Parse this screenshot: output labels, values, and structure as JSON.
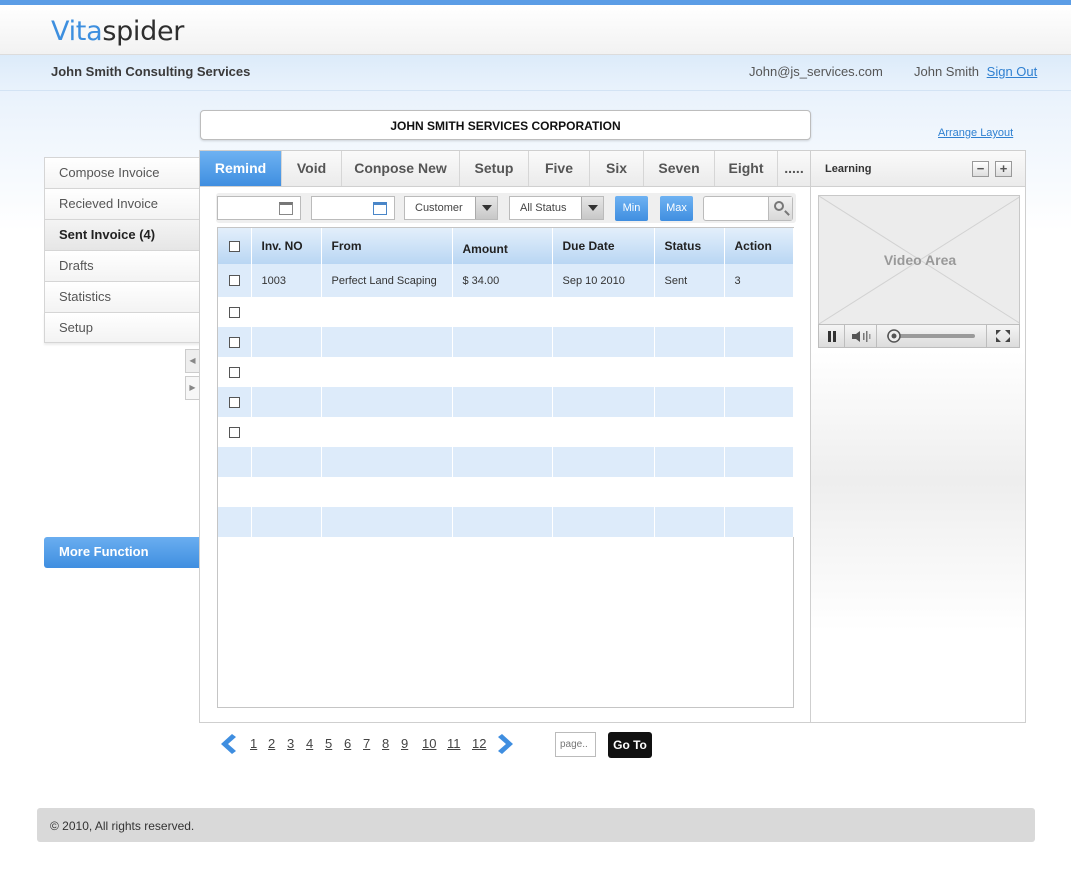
{
  "brand": {
    "logo_part1": "Vita",
    "logo_part2": "spider"
  },
  "header": {
    "company": "John Smith Consulting Services",
    "email": "John@js_services.com",
    "user": "John Smith",
    "signout_label": "Sign Out"
  },
  "corp_title": "JOHN SMITH SERVICES CORPORATION",
  "arrange_label": "Arrange Layout",
  "sidebar": {
    "items": [
      {
        "label": "Compose Invoice"
      },
      {
        "label": "Recieved Invoice"
      },
      {
        "label": "Sent Invoice (4)"
      },
      {
        "label": "Drafts"
      },
      {
        "label": "Statistics"
      },
      {
        "label": "Setup"
      }
    ],
    "more_label": "More Function"
  },
  "tabs": [
    "Remind",
    "Void",
    "Conpose New",
    "Setup",
    "Five",
    "Six",
    "Seven",
    "Eight",
    "....."
  ],
  "filters": {
    "customer": "Customer",
    "status": "All Status",
    "min_label": "Min",
    "max_label": "Max"
  },
  "table": {
    "columns": [
      "Inv. NO",
      "From",
      "Amount",
      "Due Date",
      "Status",
      "Action"
    ],
    "rows": [
      {
        "inv": "1003",
        "from": "Perfect Land Scaping",
        "amount": "$ 34.00",
        "due": "Sep 10 2010",
        "status": "Sent",
        "action": "3"
      }
    ]
  },
  "pagination": {
    "pages": [
      "1",
      "2",
      "3",
      "4",
      "5",
      "6",
      "7",
      "8",
      "9",
      "10",
      "11",
      "12"
    ],
    "page_placeholder": "page..",
    "goto_label": "Go To"
  },
  "learning": {
    "title": "Learning",
    "video_label": "Video Area"
  },
  "footer": {
    "copyright": "© 2010, All rights reserved."
  },
  "colors": {
    "accent": "#3f8ee0",
    "row_alt": "#ddebfa",
    "link": "#2f80d1"
  }
}
